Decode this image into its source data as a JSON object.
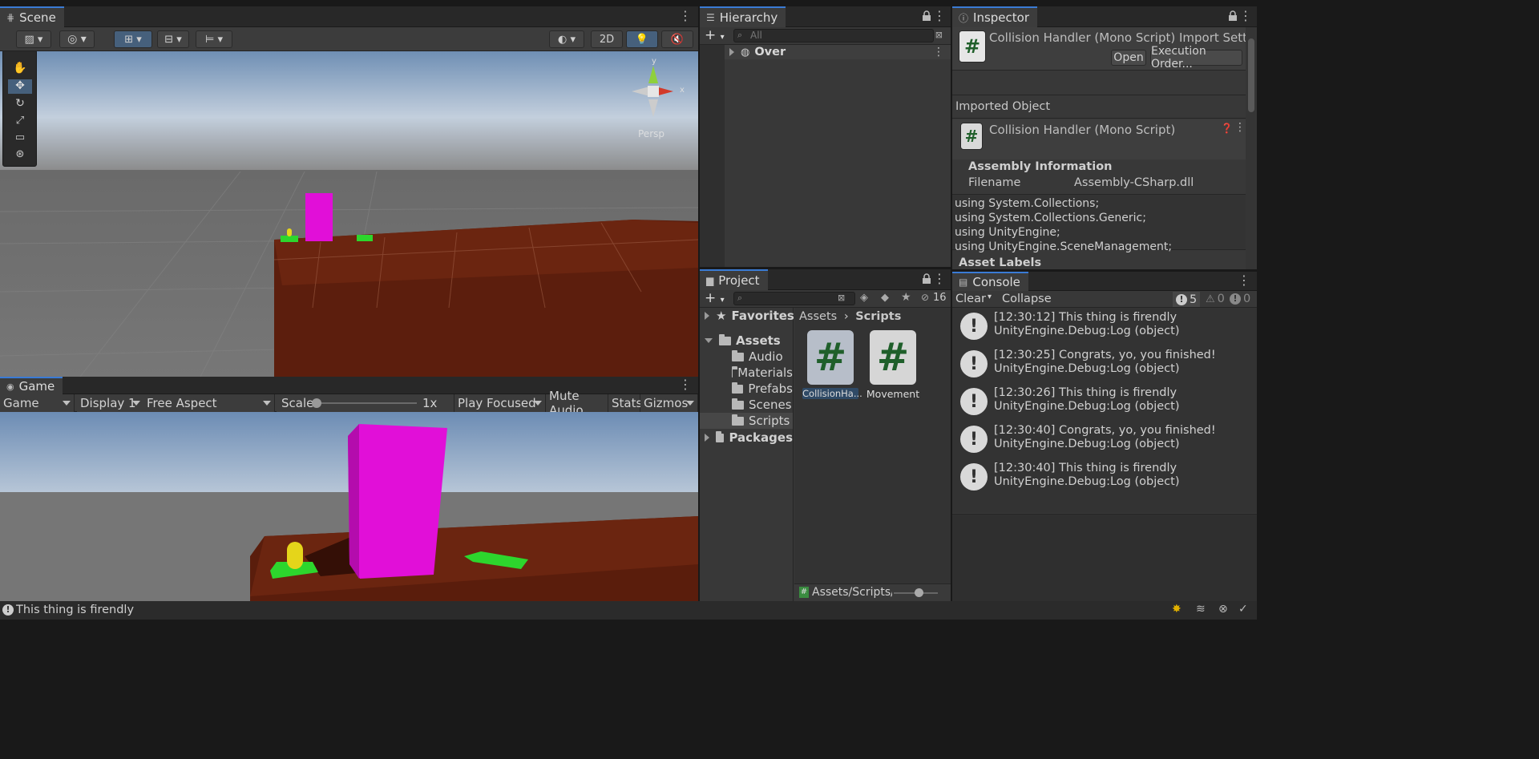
{
  "scene": {
    "tab_label": "Scene",
    "toolbar": {
      "mode_2d": "2D"
    },
    "gizmo": {
      "x": "x",
      "y": "y",
      "projection": "Persp"
    }
  },
  "game": {
    "tab_label": "Game",
    "display_mode": "Game",
    "display": "Display 1",
    "aspect": "Free Aspect",
    "scale_label": "Scale",
    "scale_value": "1x",
    "scale_fraction": 0.0,
    "play_mode": "Play Focused",
    "mute_label": "Mute Audio",
    "stats_label": "Stats",
    "gizmos_label": "Gizmos"
  },
  "hierarchy": {
    "tab_label": "Hierarchy",
    "search_placeholder": "All",
    "items": [
      {
        "label": "Over"
      }
    ]
  },
  "project": {
    "tab_label": "Project",
    "hidden_count": "16",
    "tree": {
      "favorites": "Favorites",
      "assets": "Assets",
      "folders": [
        "Audio",
        "Materials",
        "Prefabs",
        "Scenes",
        "Scripts"
      ],
      "packages": "Packages"
    },
    "breadcrumb": {
      "root": "Assets",
      "current": "Scripts"
    },
    "files": [
      {
        "label": "CollisionHa..."
      },
      {
        "label": "Movement"
      }
    ],
    "path": "Assets/Scripts/Co",
    "file_icon_glyph": "#"
  },
  "inspector": {
    "tab_label": "Inspector",
    "title": "Collision Handler (Mono Script) Import Settir",
    "open_label": "Open",
    "execution_order_label": "Execution Order...",
    "imported_object_label": "Imported Object",
    "object_title": "Collision Handler (Mono Script)",
    "assembly_header": "Assembly Information",
    "filename_label": "Filename",
    "filename_value": "Assembly-CSharp.dll",
    "code_lines": [
      "using System.Collections;",
      "using System.Collections.Generic;",
      "using UnityEngine;",
      "using UnityEngine.SceneManagement;"
    ],
    "asset_labels": "Asset Labels"
  },
  "console": {
    "tab_label": "Console",
    "clear_label": "Clear",
    "collapse_label": "Collapse",
    "log_count": "5",
    "warn_count": "0",
    "error_count": "0",
    "entries": [
      {
        "line1": "[12:30:12] This thing is firendly",
        "line2": "UnityEngine.Debug:Log (object)"
      },
      {
        "line1": "[12:30:25] Congrats, yo, you finished!",
        "line2": "UnityEngine.Debug:Log (object)"
      },
      {
        "line1": "[12:30:26] This thing is firendly",
        "line2": "UnityEngine.Debug:Log (object)"
      },
      {
        "line1": "[12:30:40] Congrats, yo, you finished!",
        "line2": "UnityEngine.Debug:Log (object)"
      },
      {
        "line1": "[12:30:40] This thing is firendly",
        "line2": "UnityEngine.Debug:Log (object)"
      }
    ]
  },
  "status_bar": {
    "message": "This thing is firendly"
  },
  "colors": {
    "accent": "#3a7bd5",
    "tile": "#6b2510",
    "pillar": "#e10fd8",
    "pad": "#2dd62d",
    "player": "#e5d51a"
  }
}
